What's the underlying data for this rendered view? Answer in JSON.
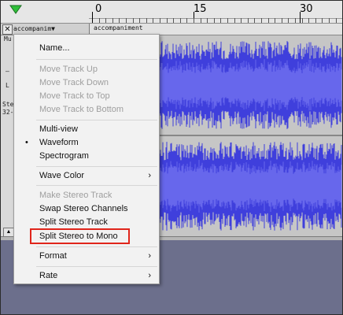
{
  "ruler": {
    "labels": [
      "0",
      "15",
      "30"
    ],
    "play_head_icon": "green-down-triangle-icon"
  },
  "track": {
    "name": "accompanim▼",
    "close_symbol": "✕",
    "collapse_symbol": "▲",
    "clip_name": "accompaniment",
    "stub_mute": "Mu",
    "stub_dash": "—",
    "stub_l": "L",
    "stub_stereo": "Ste",
    "stub_rate": "32-",
    "colors": {
      "waveform_outer": "#3f3fdc",
      "waveform_inner": "#6767ec",
      "background": "#c6c6c6"
    }
  },
  "menu": {
    "items": [
      {
        "label": "Name...",
        "enabled": true
      },
      {
        "label": "Move Track Up",
        "enabled": false
      },
      {
        "label": "Move Track Down",
        "enabled": false
      },
      {
        "label": "Move Track to Top",
        "enabled": false
      },
      {
        "label": "Move Track to Bottom",
        "enabled": false
      },
      {
        "label": "Multi-view",
        "enabled": true
      },
      {
        "label": "Waveform",
        "enabled": true,
        "checked": true
      },
      {
        "label": "Spectrogram",
        "enabled": true
      },
      {
        "label": "Wave Color",
        "enabled": true,
        "submenu": true
      },
      {
        "label": "Make Stereo Track",
        "enabled": false
      },
      {
        "label": "Swap Stereo Channels",
        "enabled": true
      },
      {
        "label": "Split Stereo Track",
        "enabled": true
      },
      {
        "label": "Split Stereo to Mono",
        "enabled": true,
        "highlighted": true
      },
      {
        "label": "Format",
        "enabled": true,
        "submenu": true
      },
      {
        "label": "Rate",
        "enabled": true,
        "submenu": true
      }
    ],
    "bullet": "•",
    "submenu_arrow": "›",
    "highlight_color": "#e0251b"
  }
}
